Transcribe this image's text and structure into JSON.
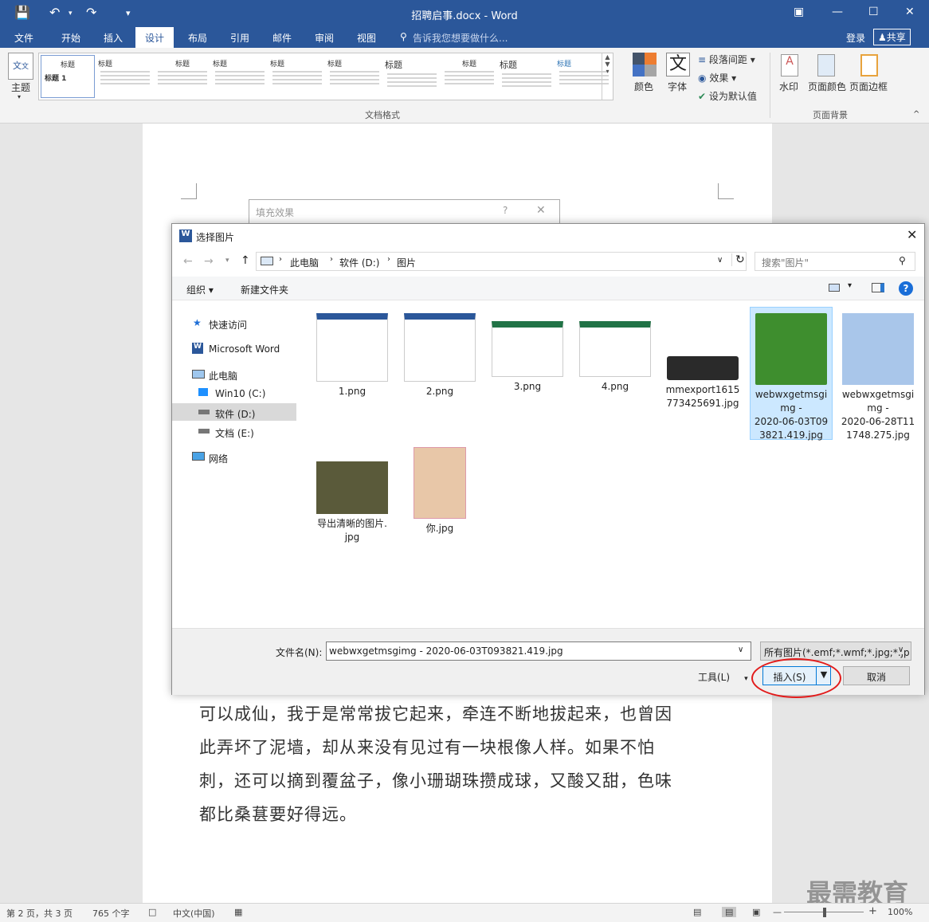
{
  "titlebar": {
    "title": "招聘启事.docx - Word"
  },
  "tabs": [
    "文件",
    "开始",
    "插入",
    "设计",
    "布局",
    "引用",
    "邮件",
    "审阅",
    "视图"
  ],
  "tell_me": "告诉我您想要做什么...",
  "login": "登录",
  "share": "共享",
  "ribbon": {
    "theme": "主题",
    "gallery_first_title": "标题",
    "gallery_first_heading": "标题 1",
    "gallery_titles": [
      "标题",
      "标题",
      "标题",
      "标题",
      "标题",
      "标题",
      "标题",
      "标题",
      "标题"
    ],
    "colors": "颜色",
    "fonts": "字体",
    "font_glyph": "文",
    "paragraph_spacing": "段落间距",
    "effects": "效果",
    "set_default": "设为默认值",
    "group_format": "文档格式",
    "watermark": "水印",
    "page_color": "页面颜色",
    "page_borders": "页面边框",
    "group_bg": "页面背景"
  },
  "document": {
    "lines": [
      "可以成仙，我于是常常拔它起来，牵连不断地拔起来，也曾因",
      "此弄坏了泥墙，却从来没有见过有一块根像人样。如果不怕",
      "刺，还可以摘到覆盆子，像小珊瑚珠攒成球，又酸又甜，色味",
      "都比桑葚要好得远。"
    ]
  },
  "fill_dialog": {
    "title": "填充效果",
    "help": "?"
  },
  "dialog": {
    "title": "选择图片",
    "breadcrumb": [
      "此电脑",
      "软件 (D:)",
      "图片"
    ],
    "search_placeholder": "搜索\"图片\"",
    "organize": "组织 ▾",
    "new_folder": "新建文件夹",
    "nav": [
      "快速访问",
      "Microsoft Word",
      "此电脑",
      "Win10 (C:)",
      "软件 (D:)",
      "文档 (E:)",
      "网络"
    ],
    "files": [
      {
        "name": "1.png"
      },
      {
        "name": "2.png"
      },
      {
        "name": "3.png"
      },
      {
        "name": "4.png"
      },
      {
        "name": "mmexport1615\n773425691.jpg"
      },
      {
        "name": "webwxgetmsgi\nmg -\n2020-06-03T09\n3821.419.jpg"
      },
      {
        "name": "webwxgetmsgi\nmg -\n2020-06-28T11\n1748.275.jpg"
      },
      {
        "name": "导出清晰的图片.\njpg"
      },
      {
        "name": "你.jpg"
      }
    ],
    "filename_label": "文件名(N):",
    "filename_value": "webwxgetmsgimg - 2020-06-03T093821.419.jpg",
    "filetype": "所有图片(*.emf;*.wmf;*.jpg;*.jp",
    "tools": "工具(L)",
    "insert": "插入(S)",
    "cancel": "取消"
  },
  "status": {
    "page": "第 2 页，共 3 页",
    "words": "765 个字",
    "lang": "中文(中国)",
    "zoom": "100%"
  },
  "watermark_logo": "最需教育",
  "colors": {
    "word_blue": "#2b579a",
    "selection": "#cce8ff",
    "highlight": "#e21b1b"
  }
}
